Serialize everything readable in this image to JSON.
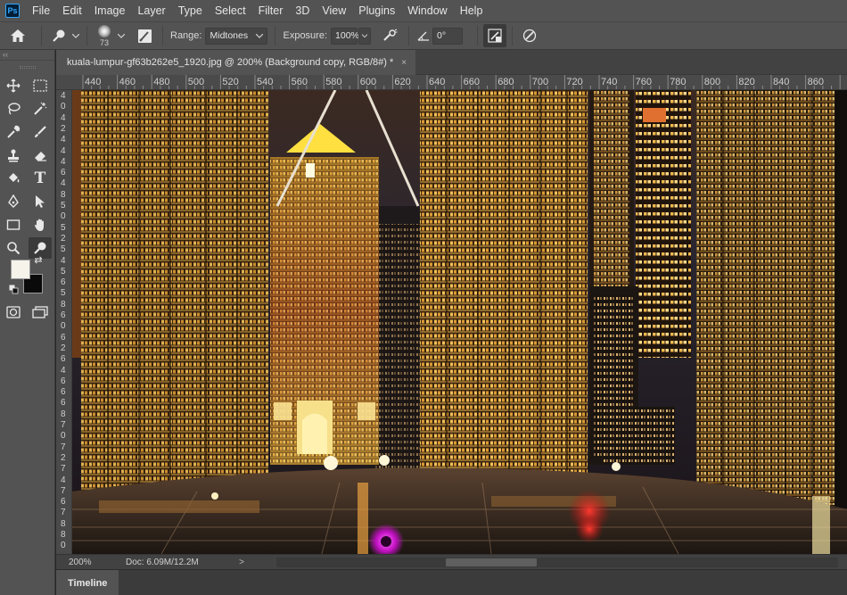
{
  "app": {
    "logo": "Ps"
  },
  "menu": [
    "File",
    "Edit",
    "Image",
    "Layer",
    "Type",
    "Select",
    "Filter",
    "3D",
    "View",
    "Plugins",
    "Window",
    "Help"
  ],
  "options": {
    "home_icon": "home-icon",
    "tool_icon": "dodge-tool-icon",
    "brush_size": "73",
    "range_label": "Range:",
    "range_value": "Midtones",
    "exposure_label": "Exposure:",
    "exposure_value": "100%",
    "angle_value": "0°"
  },
  "document": {
    "tab_title": "kuala-lumpur-gf63b262e5_1920.jpg @ 200% (Background copy, RGB/8#) *",
    "close_glyph": "×"
  },
  "ruler": {
    "h_labels": [
      "440",
      "460",
      "480",
      "500",
      "520",
      "540",
      "560",
      "580",
      "600",
      "620",
      "640",
      "660",
      "680",
      "700",
      "720",
      "740",
      "760",
      "780",
      "800",
      "820",
      "840",
      "860"
    ],
    "v_digits": [
      "4",
      "0",
      "4",
      "2",
      "4",
      "4",
      "4",
      "6",
      "4",
      "8",
      "5",
      "0",
      "5",
      "2",
      "5",
      "4",
      "5",
      "6",
      "5",
      "8",
      "6",
      "0",
      "6",
      "2",
      "6",
      "4",
      "6",
      "6",
      "6",
      "8",
      "7",
      "0",
      "7",
      "2",
      "7",
      "4",
      "7",
      "6",
      "7",
      "8",
      "8",
      "0"
    ]
  },
  "status": {
    "zoom": "200%",
    "doc": "Doc: 6.09M/12.2M",
    "arrow": ">"
  },
  "panels": {
    "timeline": "Timeline"
  },
  "colors": {
    "foreground": "#f5f3ea",
    "background": "#0a0a0a",
    "ui_panel": "#535353"
  }
}
